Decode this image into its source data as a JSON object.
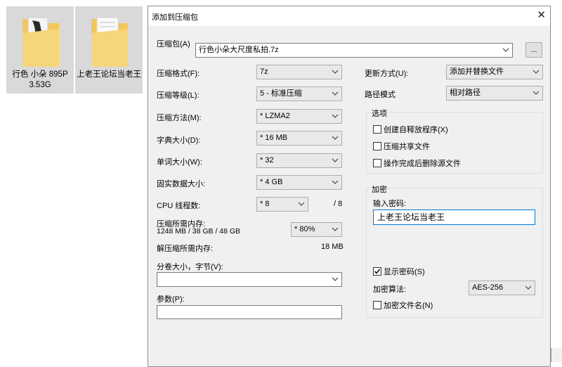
{
  "desktop": {
    "items": [
      {
        "name": "行色 小朵 895P",
        "size": "3.53G"
      },
      {
        "name": "上老王论坛当老王",
        "size": ""
      }
    ]
  },
  "dialog": {
    "title": "添加到压缩包",
    "archive_label": "压缩包(A)",
    "archive_path": "行色小朵大尺度私拍.7z",
    "browse_label": "...",
    "left": {
      "format": {
        "label": "压缩格式(F):",
        "value": "7z"
      },
      "level": {
        "label": "压缩等级(L):",
        "value": "5 - 标准压缩"
      },
      "method": {
        "label": "压缩方法(M):",
        "value": "* LZMA2"
      },
      "dict": {
        "label": "字典大小(D):",
        "value": "* 16 MB"
      },
      "word": {
        "label": "单词大小(W):",
        "value": "* 32"
      },
      "solid": {
        "label": "固实数据大小:",
        "value": "* 4 GB"
      },
      "cpu": {
        "label": "CPU 线程数:",
        "value": "* 8",
        "max": "/ 8"
      },
      "mem": {
        "label": "压缩所需内存:",
        "detail": "1248 MB / 38 GB / 48 GB",
        "value": "* 80%"
      },
      "decomp": {
        "label": "解压缩所需内存:",
        "value": "18 MB"
      },
      "volume": {
        "label": "分卷大小，字节(V):",
        "value": ""
      },
      "params": {
        "label": "参数(P):",
        "value": ""
      }
    },
    "right": {
      "update": {
        "label": "更新方式(U):",
        "value": "添加并替换文件"
      },
      "pathmode": {
        "label": "路径模式",
        "value": "相对路径"
      },
      "options": {
        "title": "选项",
        "sfx": "创建自释放程序(X)",
        "shared": "压缩共享文件",
        "delete": "操作完成后删除源文件"
      },
      "encryption": {
        "title": "加密",
        "pwd_label": "输入密码:",
        "pwd_value": "上老王论坛当老王",
        "show_pwd": "显示密码(S)",
        "algo_label": "加密算法:",
        "algo_value": "AES-256",
        "encrypt_names": "加密文件名(N)"
      }
    },
    "close_icon": "close-icon"
  }
}
